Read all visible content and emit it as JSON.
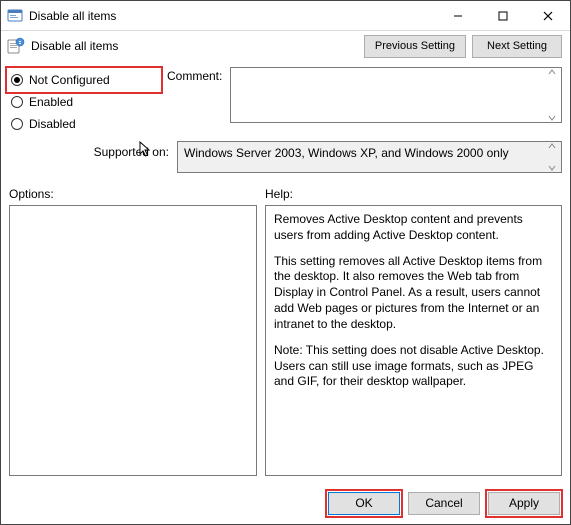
{
  "window": {
    "title": "Disable all items"
  },
  "subheader": {
    "label": "Disable all items"
  },
  "nav": {
    "prev": "Previous Setting",
    "next": "Next Setting"
  },
  "radios": {
    "not_configured": "Not Configured",
    "enabled": "Enabled",
    "disabled": "Disabled",
    "selected": "not_configured"
  },
  "comment": {
    "label": "Comment:",
    "value": ""
  },
  "supported": {
    "label": "Supported on:",
    "value": "Windows Server 2003, Windows XP, and Windows 2000 only"
  },
  "sections": {
    "options": "Options:",
    "help": "Help:"
  },
  "help": {
    "p1": "Removes Active Desktop content and prevents users from adding Active Desktop content.",
    "p2": "This setting removes all Active Desktop items from the desktop. It also removes the Web tab from Display in Control Panel. As a result, users cannot add Web pages or  pictures from the Internet or an intranet to the desktop.",
    "p3": "Note: This setting does not disable Active Desktop. Users can  still use image formats, such as JPEG and GIF, for their desktop wallpaper."
  },
  "footer": {
    "ok": "OK",
    "cancel": "Cancel",
    "apply": "Apply"
  }
}
